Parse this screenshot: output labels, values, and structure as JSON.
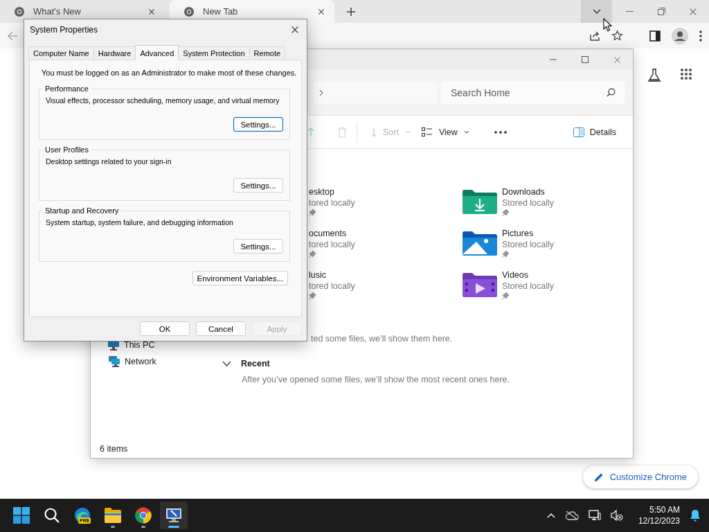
{
  "browser": {
    "tabs": [
      {
        "title": "What's New",
        "selected": false
      },
      {
        "title": "New Tab",
        "selected": true
      }
    ],
    "customize_button": "Customize Chrome"
  },
  "explorer": {
    "search": {
      "placeholder": "Search Home"
    },
    "toolbar": [
      {
        "label": "Sort",
        "disabled": true
      },
      {
        "label": "View",
        "disabled": false
      }
    ],
    "details_button": "Details",
    "items": [
      {
        "name": "esktop",
        "status": "tored locally",
        "pinned": true
      },
      {
        "name": "Downloads",
        "status": "Stored locally",
        "pinned": true,
        "kind": "downloads"
      },
      {
        "name": "ocuments",
        "status": "tored locally",
        "pinned": true
      },
      {
        "name": "Pictures",
        "status": "Stored locally",
        "pinned": true,
        "kind": "pictures"
      },
      {
        "name": "lusic",
        "status": "tored locally",
        "pinned": true
      },
      {
        "name": "Videos",
        "status": "Stored locally",
        "pinned": true,
        "kind": "videos"
      }
    ],
    "favorites_note": "ted some files, we’ll show them here.",
    "sidebar": [
      {
        "label": "This PC",
        "kind": "pc"
      },
      {
        "label": "Network",
        "kind": "network"
      }
    ],
    "recent": {
      "title": "Recent",
      "expanded": true,
      "note": "After you’ve opened some files, we’ll show the most recent ones here."
    },
    "status_bar": "6 items"
  },
  "dialog": {
    "title": "System Properties",
    "tabs": [
      {
        "label": "Computer Name",
        "selected": false
      },
      {
        "label": "Hardware",
        "selected": false
      },
      {
        "label": "Advanced",
        "selected": true
      },
      {
        "label": "System Protection",
        "selected": false
      },
      {
        "label": "Remote",
        "selected": false
      }
    ],
    "notice": "You must be logged on as an Administrator to make most of these changes.",
    "groups": [
      {
        "title": "Performance",
        "description": "Visual effects, processor scheduling, memory usage, and virtual memory",
        "button": "Settings...",
        "focused": true
      },
      {
        "title": "User Profiles",
        "description": "Desktop settings related to your sign-in",
        "button": "Settings...",
        "focused": false
      },
      {
        "title": "Startup and Recovery",
        "description": "System startup, system failure, and debugging information",
        "button": "Settings...",
        "focused": false
      }
    ],
    "env_button": "Environment Variables...",
    "buttons": [
      {
        "label": "OK",
        "disabled": false
      },
      {
        "label": "Cancel",
        "disabled": false
      },
      {
        "label": "Apply",
        "disabled": true
      }
    ]
  },
  "taskbar": {
    "apps": [
      {
        "kind": "start",
        "running": false,
        "selected": false
      },
      {
        "kind": "search",
        "running": false,
        "selected": false
      },
      {
        "kind": "edge",
        "running": false,
        "selected": false,
        "badge": "PRE"
      },
      {
        "kind": "files",
        "running": true,
        "selected": false
      },
      {
        "kind": "chrome",
        "running": true,
        "selected": false
      },
      {
        "kind": "system",
        "running": true,
        "selected": true
      }
    ],
    "time": "5:50 AM",
    "date": "12/12/2023"
  }
}
